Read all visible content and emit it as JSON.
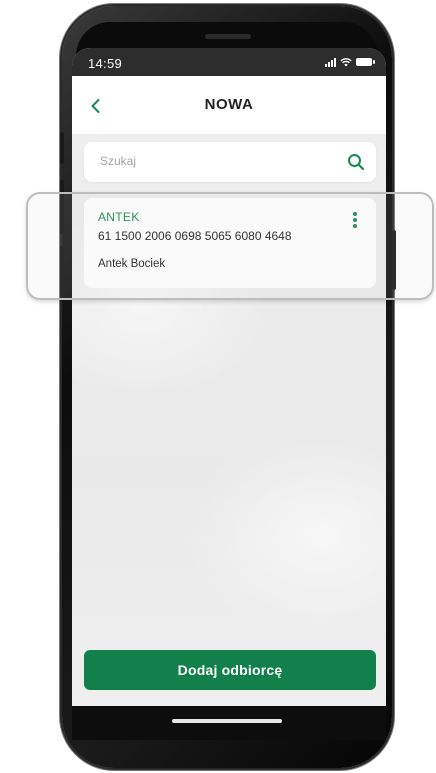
{
  "status_bar": {
    "time": "14:59"
  },
  "header": {
    "title": "NOWA",
    "back_icon": "chevron-left-icon"
  },
  "search": {
    "placeholder": "Szukaj",
    "value": "",
    "icon": "search-icon"
  },
  "recipients": [
    {
      "name": "ANTEK",
      "account": "61 1500 2006 0698 5065 6080 4648",
      "full_name": "Antek Bociek",
      "menu_icon": "more-vertical-icon"
    }
  ],
  "actions": {
    "add_recipient_label": "Dodaj odbiorcę"
  },
  "colors": {
    "accent": "#12804b",
    "accent_text": "#1a8a4f",
    "status_bar_bg": "#2d2d2d",
    "background": "#efefef"
  }
}
